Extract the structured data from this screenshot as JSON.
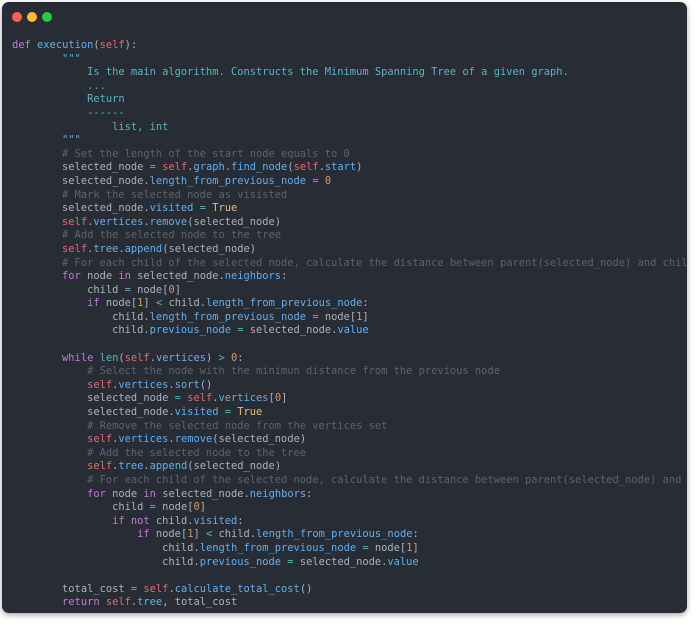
{
  "window": {
    "controls": [
      "close",
      "minimize",
      "maximize"
    ],
    "colors": {
      "background": "#282c34",
      "close": "#ff5f56",
      "minimize": "#ffbd2e",
      "maximize": "#27c93f"
    }
  },
  "code": {
    "language": "python",
    "lines": [
      "def execution(self):",
      "        \"\"\"",
      "            Is the main algorithm. Constructs the Minimum Spanning Tree of a given graph.",
      "            ...",
      "            Return",
      "            ------",
      "                list, int",
      "        \"\"\"",
      "        # Set the length of the start node equals to 0",
      "        selected_node = self.graph.find_node(self.start)",
      "        selected_node.length_from_previous_node = 0",
      "        # Mark the selected node as visisted",
      "        selected_node.visited = True",
      "        self.vertices.remove(selected_node)",
      "        # Add the selected node to the tree",
      "        self.tree.append(selected_node)",
      "        # For each child of the selected node, calculate the distance between parent(selected_node) and child",
      "        for node in selected_node.neighbors:",
      "            child = node[0]",
      "            if node[1] < child.length_from_previous_node:",
      "                child.length_from_previous_node = node[1]",
      "                child.previous_node = selected_node.value",
      "",
      "        while len(self.vertices) > 0:",
      "            # Select the node with the minimun distance from the previous node",
      "            self.vertices.sort()",
      "            selected_node = self.vertices[0]",
      "            selected_node.visited = True",
      "            # Remove the selected node from the vertices set",
      "            self.vertices.remove(selected_node)",
      "            # Add the selected node to the tree",
      "            self.tree.append(selected_node)",
      "            # For each child of the selected node, calculate the distance between parent(selected_node) and",
      "            for node in selected_node.neighbors:",
      "                child = node[0]",
      "                if not child.visited:",
      "                    if node[1] < child.length_from_previous_node:",
      "                        child.length_from_previous_node = node[1]",
      "                        child.previous_node = selected_node.value",
      "",
      "        total_cost = self.calculate_total_cost()",
      "        return self.tree, total_cost"
    ]
  }
}
